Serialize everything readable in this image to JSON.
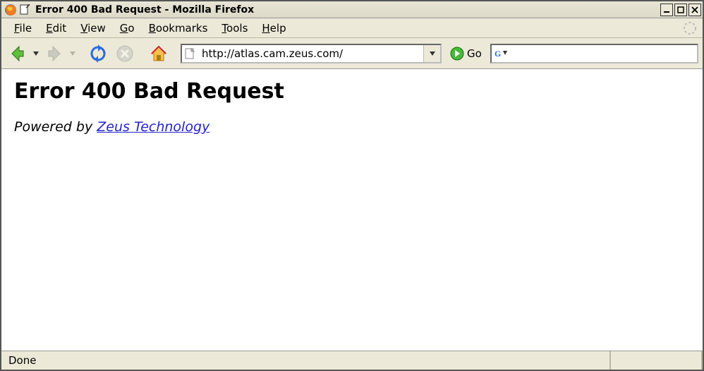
{
  "window": {
    "title": "Error 400 Bad Request - Mozilla Firefox"
  },
  "menu": {
    "file": "File",
    "edit": "Edit",
    "view": "View",
    "go": "Go",
    "bookmarks": "Bookmarks",
    "tools": "Tools",
    "help": "Help"
  },
  "toolbar": {
    "url_value": "http://atlas.cam.zeus.com/",
    "go_label": "Go",
    "search_value": ""
  },
  "page": {
    "heading": "Error 400 Bad Request",
    "powered_by_prefix": "Powered by ",
    "powered_by_link": "Zeus Technology"
  },
  "status": {
    "text": "Done"
  }
}
